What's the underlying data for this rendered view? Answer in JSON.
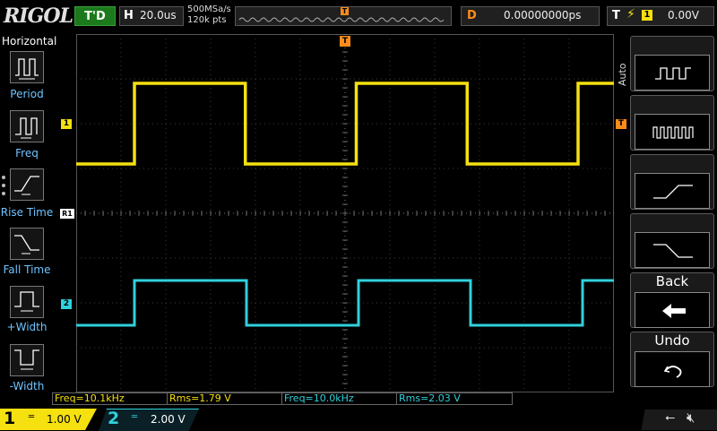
{
  "brand": "RIGOL",
  "status": "T'D",
  "timebase": {
    "label": "H",
    "value": "20.0us"
  },
  "sample_rate": "500MSa/s",
  "memory_depth": "120k pts",
  "overview_trigger_marker": "T",
  "delay": {
    "label": "D",
    "value": "0.00000000ps"
  },
  "trigger": {
    "label": "T",
    "edge_icon": "rising-edge-icon",
    "source": "1",
    "level": "0.00V"
  },
  "menu": {
    "title": "Horizontal",
    "items": [
      {
        "label": "Period",
        "icon": "period-icon"
      },
      {
        "label": "Freq",
        "icon": "freq-icon"
      },
      {
        "label": "Rise Time",
        "icon": "rise-time-icon"
      },
      {
        "label": "Fall Time",
        "icon": "fall-time-icon"
      },
      {
        "label": "+Width",
        "icon": "positive-width-icon"
      },
      {
        "label": "-Width",
        "icon": "negative-width-icon"
      }
    ]
  },
  "softkeys": {
    "auto_label": "Auto",
    "back_label": "Back",
    "undo_label": "Undo"
  },
  "markers": {
    "ch1": "1",
    "ch2": "2",
    "ref": "R1",
    "trig_level": "T",
    "trig_pos": "T"
  },
  "measurements": [
    {
      "text": "Freq=10.1kHz",
      "color": "#f5e010"
    },
    {
      "text": "Rms=1.79 V",
      "color": "#f5e010"
    },
    {
      "text": "Freq=10.0kHz",
      "color": "#2fd1dc"
    },
    {
      "text": "Rms=2.03 V",
      "color": "#2fd1dc"
    }
  ],
  "channels": [
    {
      "num": "1",
      "coupling": "═",
      "scale": "1.00 V",
      "color": "#f5e010"
    },
    {
      "num": "2",
      "coupling": "═",
      "scale": "2.00 V",
      "color": "#2fd1dc"
    }
  ],
  "colors": {
    "ch1": "#f5e010",
    "ch2": "#2fd1dc",
    "trigger": "#ff8c1a",
    "menu_label": "#6fc3ff"
  },
  "waveforms": {
    "time_per_div_us": 20,
    "divisions": 12,
    "ch1": {
      "period_us": 99,
      "low_div": -0.9,
      "high_div": 0.9,
      "first_rise_us": 10
    },
    "ch2": {
      "period_us": 100,
      "low_div": -0.5,
      "high_div": 0.5,
      "first_rise_us": 10
    }
  }
}
